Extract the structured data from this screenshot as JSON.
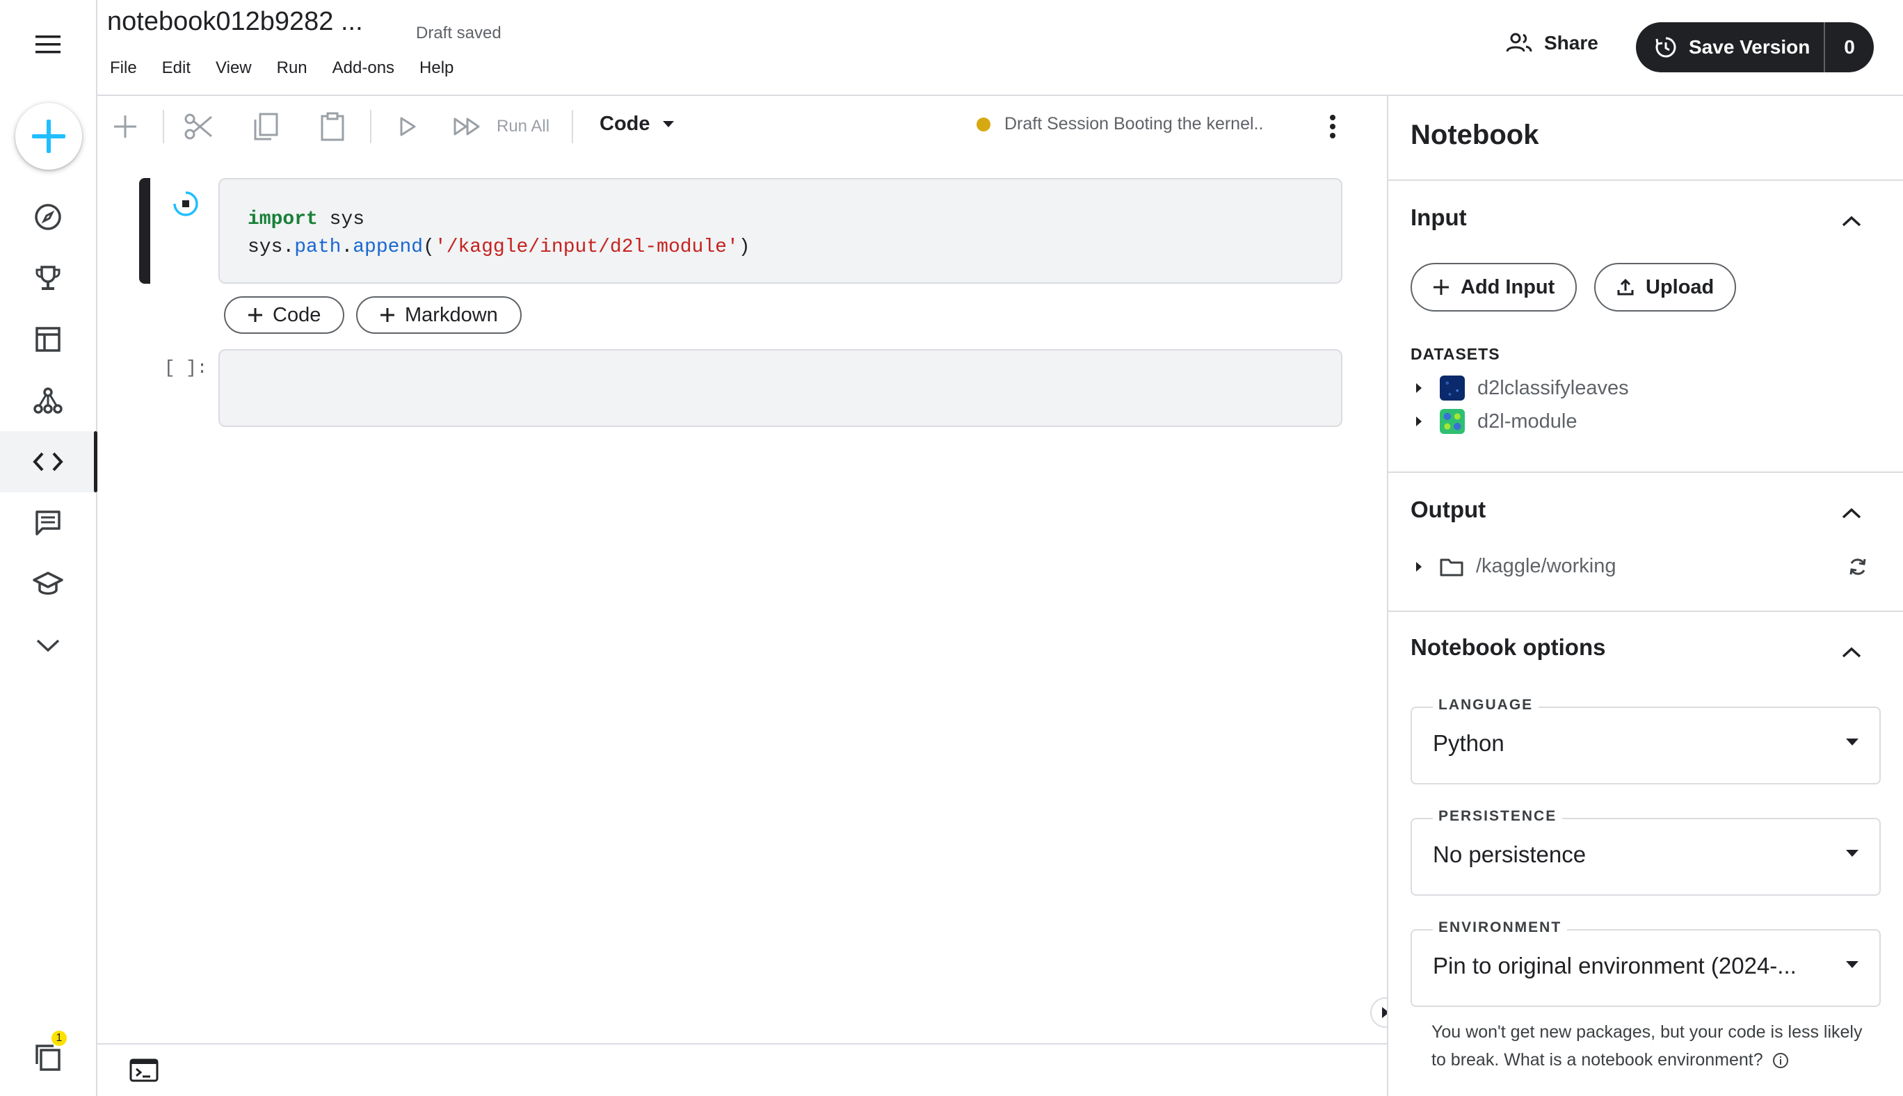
{
  "header": {
    "title": "notebook012b9282 ...",
    "save_status": "Draft saved",
    "menu": [
      "File",
      "Edit",
      "View",
      "Run",
      "Add-ons",
      "Help"
    ],
    "share_label": "Share",
    "save_version_label": "Save Version",
    "version_count": "0"
  },
  "toolbar": {
    "run_all_label": "Run All",
    "cell_type": "Code",
    "session_status": "Draft Session Booting the kernel.."
  },
  "cells": {
    "cell1": {
      "line1_kw": "import",
      "line1_rest": " sys",
      "line2_obj": "sys.",
      "line2_attr1": "path",
      "line2_dot": ".",
      "line2_attr2": "append",
      "line2_open": "(",
      "line2_str": "'/kaggle/input/d2l-module'",
      "line2_close": ")"
    },
    "add_code_label": "Code",
    "add_markdown_label": "Markdown",
    "cell2_prompt": "[ ]:"
  },
  "sidebar": {
    "notification_count": "1"
  },
  "panel": {
    "title": "Notebook",
    "input": {
      "title": "Input",
      "add_input_label": "Add Input",
      "upload_label": "Upload",
      "datasets_label": "DATASETS",
      "datasets": [
        "d2lclassifyleaves",
        "d2l-module"
      ]
    },
    "output": {
      "title": "Output",
      "path": "/kaggle/working"
    },
    "options": {
      "title": "Notebook options",
      "language_label": "LANGUAGE",
      "language_value": "Python",
      "persistence_label": "PERSISTENCE",
      "persistence_value": "No persistence",
      "environment_label": "ENVIRONMENT",
      "environment_value": "Pin to original environment (2024-...",
      "environment_note": "You won't get new packages, but your code is less likely to break. What is a notebook environment?"
    }
  },
  "colors": {
    "accent_blue": "#20beff",
    "session_dot": "#d6a812",
    "dark": "#202124"
  }
}
